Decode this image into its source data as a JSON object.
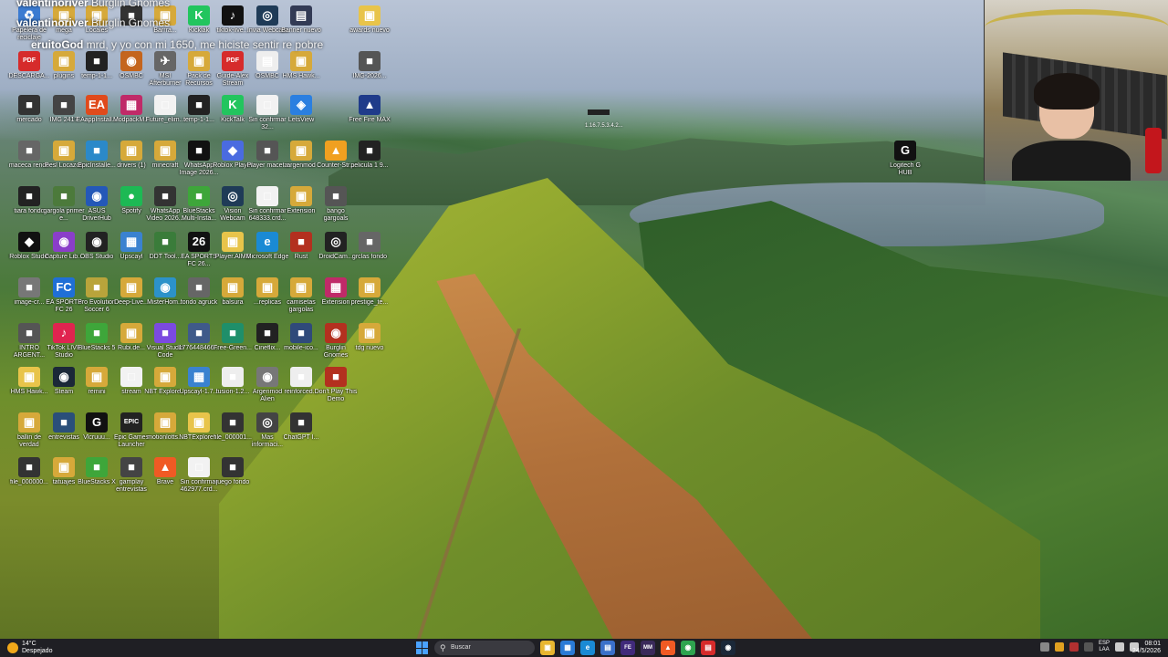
{
  "chat": [
    {
      "user": "valentinoriver",
      "message": "Burglin Gnomes"
    },
    {
      "user": "valentinoriver",
      "message": "Burglin Gnomes"
    },
    {
      "user": "eruitoGod",
      "message": "mrd, y yo con mi 1650, me hiciste sentir re pobre"
    }
  ],
  "desktop_icons": [
    {
      "label": "Papelera de reciclaje",
      "glyph": "♻",
      "color": "#3b7bd1"
    },
    {
      "label": "mega",
      "glyph": "▣",
      "color": "#d6a93a"
    },
    {
      "label": "Locales",
      "glyph": "▣",
      "color": "#d6a93a"
    },
    {
      "label": "",
      "glyph": "■",
      "color": "#333333"
    },
    {
      "label": "Barrra...",
      "glyph": "▣",
      "color": "#d6a93a"
    },
    {
      "label": "Kicklak",
      "glyph": "K",
      "color": "#22c55e"
    },
    {
      "label": "tiktok-live...",
      "glyph": "♪",
      "color": "#111111"
    },
    {
      "label": "Invia Webcam",
      "glyph": "◎",
      "color": "#1f3b57"
    },
    {
      "label": "Banner nuevo",
      "glyph": "▤",
      "color": "#333b55"
    },
    {
      "label": "awards nuevo",
      "glyph": "▣",
      "color": "#e8c44a"
    },
    {
      "label": "DESCARGA...",
      "glyph": "PDF",
      "color": "#d62b2b"
    },
    {
      "label": "plugins",
      "glyph": "▣",
      "color": "#d6a93a"
    },
    {
      "label": "temp-1-1...",
      "glyph": "■",
      "color": "#222222"
    },
    {
      "label": "OSMBC",
      "glyph": "◉",
      "color": "#c4651d"
    },
    {
      "label": "MSI Afterburner",
      "glyph": "✈",
      "color": "#666666"
    },
    {
      "label": "Pack de Recursos",
      "glyph": "▣",
      "color": "#d6a93a"
    },
    {
      "label": "Guide-Alex Stream",
      "glyph": "PDF",
      "color": "#d62b2b"
    },
    {
      "label": "OSMBC",
      "glyph": "▤",
      "color": "#eeeeee"
    },
    {
      "label": "HMS Hawk...",
      "glyph": "▣",
      "color": "#d6a93a"
    },
    {
      "label": "IMG-2026...",
      "glyph": "■",
      "color": "#555555"
    },
    {
      "label": "mercado",
      "glyph": "■",
      "color": "#333333"
    },
    {
      "label": "IMG 2417",
      "glyph": "■",
      "color": "#444444"
    },
    {
      "label": "EAappInstall...",
      "glyph": "EA",
      "color": "#e04a1c"
    },
    {
      "label": "ModpackM...",
      "glyph": "▦",
      "color": "#c02a68"
    },
    {
      "label": "Future_elim...",
      "glyph": "□",
      "color": "#f2f2f2"
    },
    {
      "label": "temp-1-1...",
      "glyph": "■",
      "color": "#222222"
    },
    {
      "label": "KickTalk",
      "glyph": "K",
      "color": "#22c55e"
    },
    {
      "label": "Sin confirmar 32...",
      "glyph": "□",
      "color": "#f2f2f2"
    },
    {
      "label": "LetsView",
      "glyph": "◈",
      "color": "#2b7fe0"
    },
    {
      "label": "Free Fire MAX",
      "glyph": "▲",
      "color": "#1f3b8a"
    },
    {
      "label": "maceca rendo",
      "glyph": "■",
      "color": "#666666"
    },
    {
      "label": "Pesl Locazos",
      "glyph": "▣",
      "color": "#d6a93a"
    },
    {
      "label": "EpicInstalle...",
      "glyph": "■",
      "color": "#2b89c9"
    },
    {
      "label": "drivers (1)",
      "glyph": "▣",
      "color": "#d6a93a"
    },
    {
      "label": "minecraft",
      "glyph": "▣",
      "color": "#d6a93a"
    },
    {
      "label": "WhatsApp Image 2026...",
      "glyph": "■",
      "color": "#111111"
    },
    {
      "label": "Roblox Player",
      "glyph": "◆",
      "color": "#4a6be0"
    },
    {
      "label": "Player maceta",
      "glyph": "■",
      "color": "#555555"
    },
    {
      "label": "argenmod",
      "glyph": "▣",
      "color": "#d6a93a"
    },
    {
      "label": "Counter-Str...",
      "glyph": "▲",
      "color": "#f0a020"
    },
    {
      "label": "pelicula 1 9...",
      "glyph": "■",
      "color": "#222222"
    },
    {
      "label": "tiara fondo",
      "glyph": "■",
      "color": "#222222"
    },
    {
      "label": "gargola primer e...",
      "glyph": "■",
      "color": "#4c7a3b"
    },
    {
      "label": "ASUS DriverHub",
      "glyph": "◉",
      "color": "#2458b8"
    },
    {
      "label": "Spotify",
      "glyph": "●",
      "color": "#1db954"
    },
    {
      "label": "WhatsApp Video 2026...",
      "glyph": "■",
      "color": "#333333"
    },
    {
      "label": "BlueStacks Multi-Insta...",
      "glyph": "■",
      "color": "#3ea63a"
    },
    {
      "label": "Vision Webcam",
      "glyph": "◎",
      "color": "#1f3b57"
    },
    {
      "label": "Sin confirmar 648333.crd...",
      "glyph": "□",
      "color": "#f2f2f2"
    },
    {
      "label": "Extension",
      "glyph": "▣",
      "color": "#d6a93a"
    },
    {
      "label": "bango gargoals",
      "glyph": "■",
      "color": "#555555"
    },
    {
      "label": "Logitech G HUB",
      "glyph": "G",
      "color": "#111111"
    },
    {
      "label": "Roblox Studio",
      "glyph": "◆",
      "color": "#111111"
    },
    {
      "label": "Capture Lib...",
      "glyph": "◉",
      "color": "#8a3ec9"
    },
    {
      "label": "OBS Studio",
      "glyph": "◉",
      "color": "#222222"
    },
    {
      "label": "Upscayl",
      "glyph": "▦",
      "color": "#3a82d0"
    },
    {
      "label": "DDT Tool...",
      "glyph": "■",
      "color": "#3a7c3a"
    },
    {
      "label": "EA SPORTS FC 26...",
      "glyph": "26",
      "color": "#111111"
    },
    {
      "label": "Player.AIME",
      "glyph": "▣",
      "color": "#e8c44a"
    },
    {
      "label": "Microsoft Edge",
      "glyph": "e",
      "color": "#1a8ad4"
    },
    {
      "label": "Rust",
      "glyph": "■",
      "color": "#b3301f"
    },
    {
      "label": "DroidCam...",
      "glyph": "◎",
      "color": "#222222"
    },
    {
      "label": "grclas fondo",
      "glyph": "■",
      "color": "#666666"
    },
    {
      "label": "image-cr...",
      "glyph": "■",
      "color": "#777777"
    },
    {
      "label": "EA SPORTS FC 26",
      "glyph": "FC",
      "color": "#1f6fd6"
    },
    {
      "label": "Pro Evolution Soccer 6",
      "glyph": "■",
      "color": "#b9a43b"
    },
    {
      "label": "Deep-Live...",
      "glyph": "▣",
      "color": "#d6a93a"
    },
    {
      "label": "MisterHom...",
      "glyph": "◉",
      "color": "#2c92c9"
    },
    {
      "label": "fondo agruck",
      "glyph": "■",
      "color": "#666666"
    },
    {
      "label": "balsura",
      "glyph": "▣",
      "color": "#d6a93a"
    },
    {
      "label": "...replicas",
      "glyph": "▣",
      "color": "#d6a93a"
    },
    {
      "label": "camisetas gargolas",
      "glyph": "▣",
      "color": "#d6a93a"
    },
    {
      "label": "Extension",
      "glyph": "▦",
      "color": "#c02a68"
    },
    {
      "label": "prestige_te...",
      "glyph": "▣",
      "color": "#d6a93a"
    },
    {
      "label": "INTRO ARGENT...",
      "glyph": "■",
      "color": "#555555"
    },
    {
      "label": "TikTok LIVE Studio",
      "glyph": "♪",
      "color": "#e0244f"
    },
    {
      "label": "BlueStacks 5",
      "glyph": "■",
      "color": "#3ea63a"
    },
    {
      "label": "Rubi.de...",
      "glyph": "▣",
      "color": "#d6a93a"
    },
    {
      "label": "Visual Studio Code",
      "glyph": "■",
      "color": "#7b4ae0"
    },
    {
      "label": "1776448466...",
      "glyph": "■",
      "color": "#3f5a8a"
    },
    {
      "label": "Free-Green...",
      "glyph": "■",
      "color": "#1f8f6a"
    },
    {
      "label": "Cineflix...",
      "glyph": "■",
      "color": "#222222"
    },
    {
      "label": "mobile-ico...",
      "glyph": "■",
      "color": "#2f4a7a"
    },
    {
      "label": "Burglin Gnomes",
      "glyph": "◉",
      "color": "#b3301f"
    },
    {
      "label": "tdg nuevo",
      "glyph": "▣",
      "color": "#d6a93a"
    },
    {
      "label": "HMS Hawk...",
      "glyph": "▣",
      "color": "#e8c44a"
    },
    {
      "label": "Steam",
      "glyph": "◉",
      "color": "#1b2838"
    },
    {
      "label": "remini",
      "glyph": "▣",
      "color": "#d6a93a"
    },
    {
      "label": "stream",
      "glyph": "□",
      "color": "#f2f2f2"
    },
    {
      "label": "NBT Explore...",
      "glyph": "▣",
      "color": "#d6a93a"
    },
    {
      "label": "Upscayl-1.7...",
      "glyph": "▦",
      "color": "#3a82d0"
    },
    {
      "label": "fusion-1.2...",
      "glyph": "■",
      "color": "#eeeeee"
    },
    {
      "label": "Argenmod Alien",
      "glyph": "◉",
      "color": "#777777"
    },
    {
      "label": "reinforced...",
      "glyph": "■",
      "color": "#eeeeee"
    },
    {
      "label": "Don't Play This Demo",
      "glyph": "■",
      "color": "#b3301f"
    },
    {
      "label": "ballin de verdad",
      "glyph": "▣",
      "color": "#d6a93a"
    },
    {
      "label": "entrevistas",
      "glyph": "■",
      "color": "#2a4f7a"
    },
    {
      "label": "Vlcruuu...",
      "glyph": "G",
      "color": "#111111"
    },
    {
      "label": "Epic Games Launcher",
      "glyph": "EPIC",
      "color": "#222222"
    },
    {
      "label": "motionlotts...",
      "glyph": "▣",
      "color": "#d6a93a"
    },
    {
      "label": "NBTExplore...",
      "glyph": "▣",
      "color": "#e8c44a"
    },
    {
      "label": "file_000001...",
      "glyph": "■",
      "color": "#333333"
    },
    {
      "label": "Mas informaci...",
      "glyph": "◎",
      "color": "#444444"
    },
    {
      "label": "ChatGPT I...",
      "glyph": "■",
      "color": "#333333"
    },
    {
      "label": "file_000000...",
      "glyph": "■",
      "color": "#333333"
    },
    {
      "label": "tatuajes",
      "glyph": "▣",
      "color": "#d6a93a"
    },
    {
      "label": "BlueStacks X",
      "glyph": "■",
      "color": "#3ea63a"
    },
    {
      "label": "gamplay entrevistas",
      "glyph": "■",
      "color": "#444444"
    },
    {
      "label": "Brave",
      "glyph": "▲",
      "color": "#f05a24"
    },
    {
      "label": "Sin confirmar 462977.crd...",
      "glyph": "□",
      "color": "#f2f2f2"
    },
    {
      "label": "juego fondo",
      "glyph": "■",
      "color": "#333333"
    },
    {
      "label": "ahiaro",
      "glyph": "▣",
      "color": "#d6a93a"
    }
  ],
  "floating_icon": {
    "label": "1.16.7.5.3.4.2..."
  },
  "taskbar": {
    "weather_temp": "14°C",
    "weather_desc": "Despejado",
    "search_placeholder": "Buscar",
    "search_icon": "search-icon",
    "apps": [
      {
        "name": "file-explorer-icon",
        "glyph": "▣",
        "color": "#e8b630"
      },
      {
        "name": "widgets-icon",
        "glyph": "▦",
        "color": "#2a7bd6"
      },
      {
        "name": "edge-icon",
        "glyph": "e",
        "color": "#1a8ad4"
      },
      {
        "name": "store-icon",
        "glyph": "▤",
        "color": "#3a70c9"
      },
      {
        "name": "fe-icon",
        "glyph": "FE",
        "color": "#402a7a"
      },
      {
        "name": "mm-icon",
        "glyph": "MM",
        "color": "#3a2a5a"
      },
      {
        "name": "brave-icon",
        "glyph": "▲",
        "color": "#f05a24"
      },
      {
        "name": "chrome-icon",
        "glyph": "◉",
        "color": "#2ea44f"
      },
      {
        "name": "pdf-icon",
        "glyph": "▤",
        "color": "#d62b2b"
      },
      {
        "name": "steam-icon",
        "glyph": "◉",
        "color": "#1b2838"
      }
    ],
    "lang_top": "ESP",
    "lang_bottom": "LAA",
    "time": "08:01",
    "date": "24/5/2026"
  }
}
